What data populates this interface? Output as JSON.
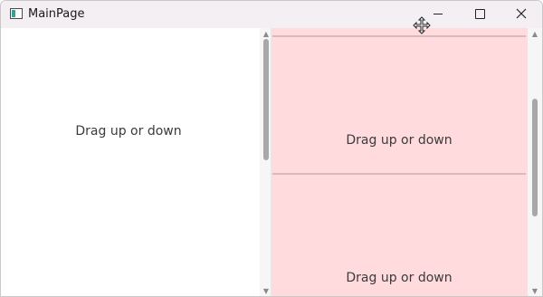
{
  "window": {
    "title": "MainPage"
  },
  "left_pane": {
    "label": "Drag up or down"
  },
  "right_pane": {
    "cards": [
      {
        "label": "Drag up or down"
      },
      {
        "label": "Drag up or down"
      }
    ]
  },
  "icons": {
    "app": "app-window-icon",
    "minimize": "minimize-icon",
    "maximize": "maximize-icon",
    "close": "close-icon",
    "cursor": "move-cursor-icon"
  },
  "colors": {
    "titlebar": "#f3eff3",
    "right_pane_background": "#ffdbde",
    "card_border": "#d8b9bc",
    "text": "#3b3b3b"
  }
}
